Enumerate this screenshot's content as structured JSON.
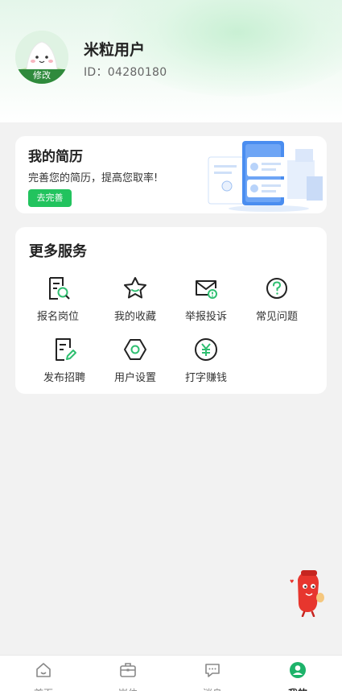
{
  "profile": {
    "name": "米粒用户",
    "id_text": "ID：04280180",
    "avatar_badge": "修改"
  },
  "resume": {
    "title": "我的简历",
    "subtitle": "完善您的简历，提高您取率!",
    "button": "去完善"
  },
  "services": {
    "title": "更多服务",
    "items": [
      {
        "label": "报名岗位",
        "icon": "document-search-icon"
      },
      {
        "label": "我的收藏",
        "icon": "star-icon"
      },
      {
        "label": "举报投诉",
        "icon": "mail-alert-icon"
      },
      {
        "label": "常见问题",
        "icon": "question-icon"
      },
      {
        "label": "发布招聘",
        "icon": "document-edit-icon"
      },
      {
        "label": "用户设置",
        "icon": "settings-hex-icon"
      },
      {
        "label": "打字赚钱",
        "icon": "yuan-coin-icon"
      }
    ]
  },
  "tabs": [
    {
      "label": "首页",
      "icon": "home-icon",
      "active": false
    },
    {
      "label": "岗位",
      "icon": "briefcase-icon",
      "active": false
    },
    {
      "label": "消息",
      "icon": "message-icon",
      "active": false
    },
    {
      "label": "我的",
      "icon": "user-icon",
      "active": true
    }
  ],
  "colors": {
    "accent": "#22c35e",
    "badge_green": "#2f8a3c",
    "page_bg": "#f2f2f2"
  }
}
